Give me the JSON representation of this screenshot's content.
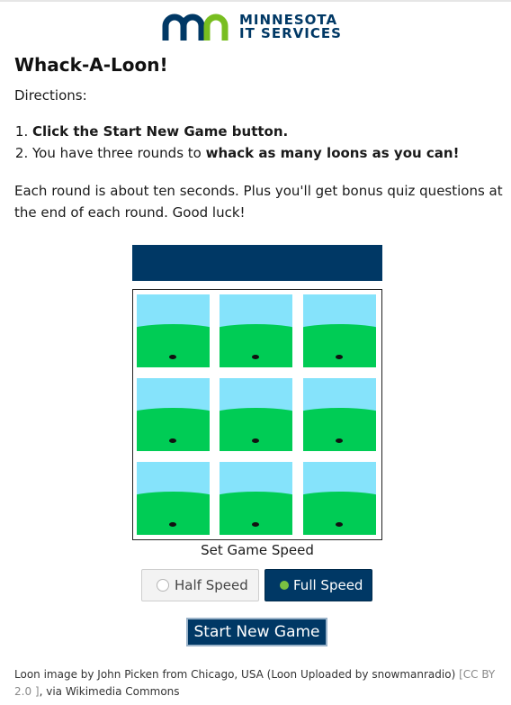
{
  "header": {
    "logo_line1": "MINNESOTA",
    "logo_line2": "IT SERVICES",
    "brand_color": "#003865",
    "accent_color": "#78be20"
  },
  "page": {
    "title": "Whack-A-Loon!",
    "directions_label": "Directions:",
    "steps": [
      {
        "bold": "Click the Start New Game button.",
        "pre": "",
        "post": ""
      },
      {
        "pre": "You have three rounds to ",
        "bold": "whack as many loons as you can!",
        "post": ""
      }
    ],
    "note": "Each round is about ten seconds. Plus you'll get bonus quiz questions at the end of each round. Good luck!"
  },
  "game": {
    "board_colors": {
      "sky": "#85e3fb",
      "grass": "#00cc55",
      "banner": "#003865"
    },
    "holes": 9,
    "speed_label": "Set Game Speed",
    "speed_options": [
      {
        "label": "Half Speed",
        "selected": false
      },
      {
        "label": "Full Speed",
        "selected": true
      }
    ],
    "start_button": "Start New Game"
  },
  "credit": {
    "text": "Loon image by John Picken from Chicago, USA (Loon Uploaded by snowmanradio) ",
    "license": "[CC BY 2.0 ]",
    "suffix": ", via Wikimedia Commons"
  }
}
